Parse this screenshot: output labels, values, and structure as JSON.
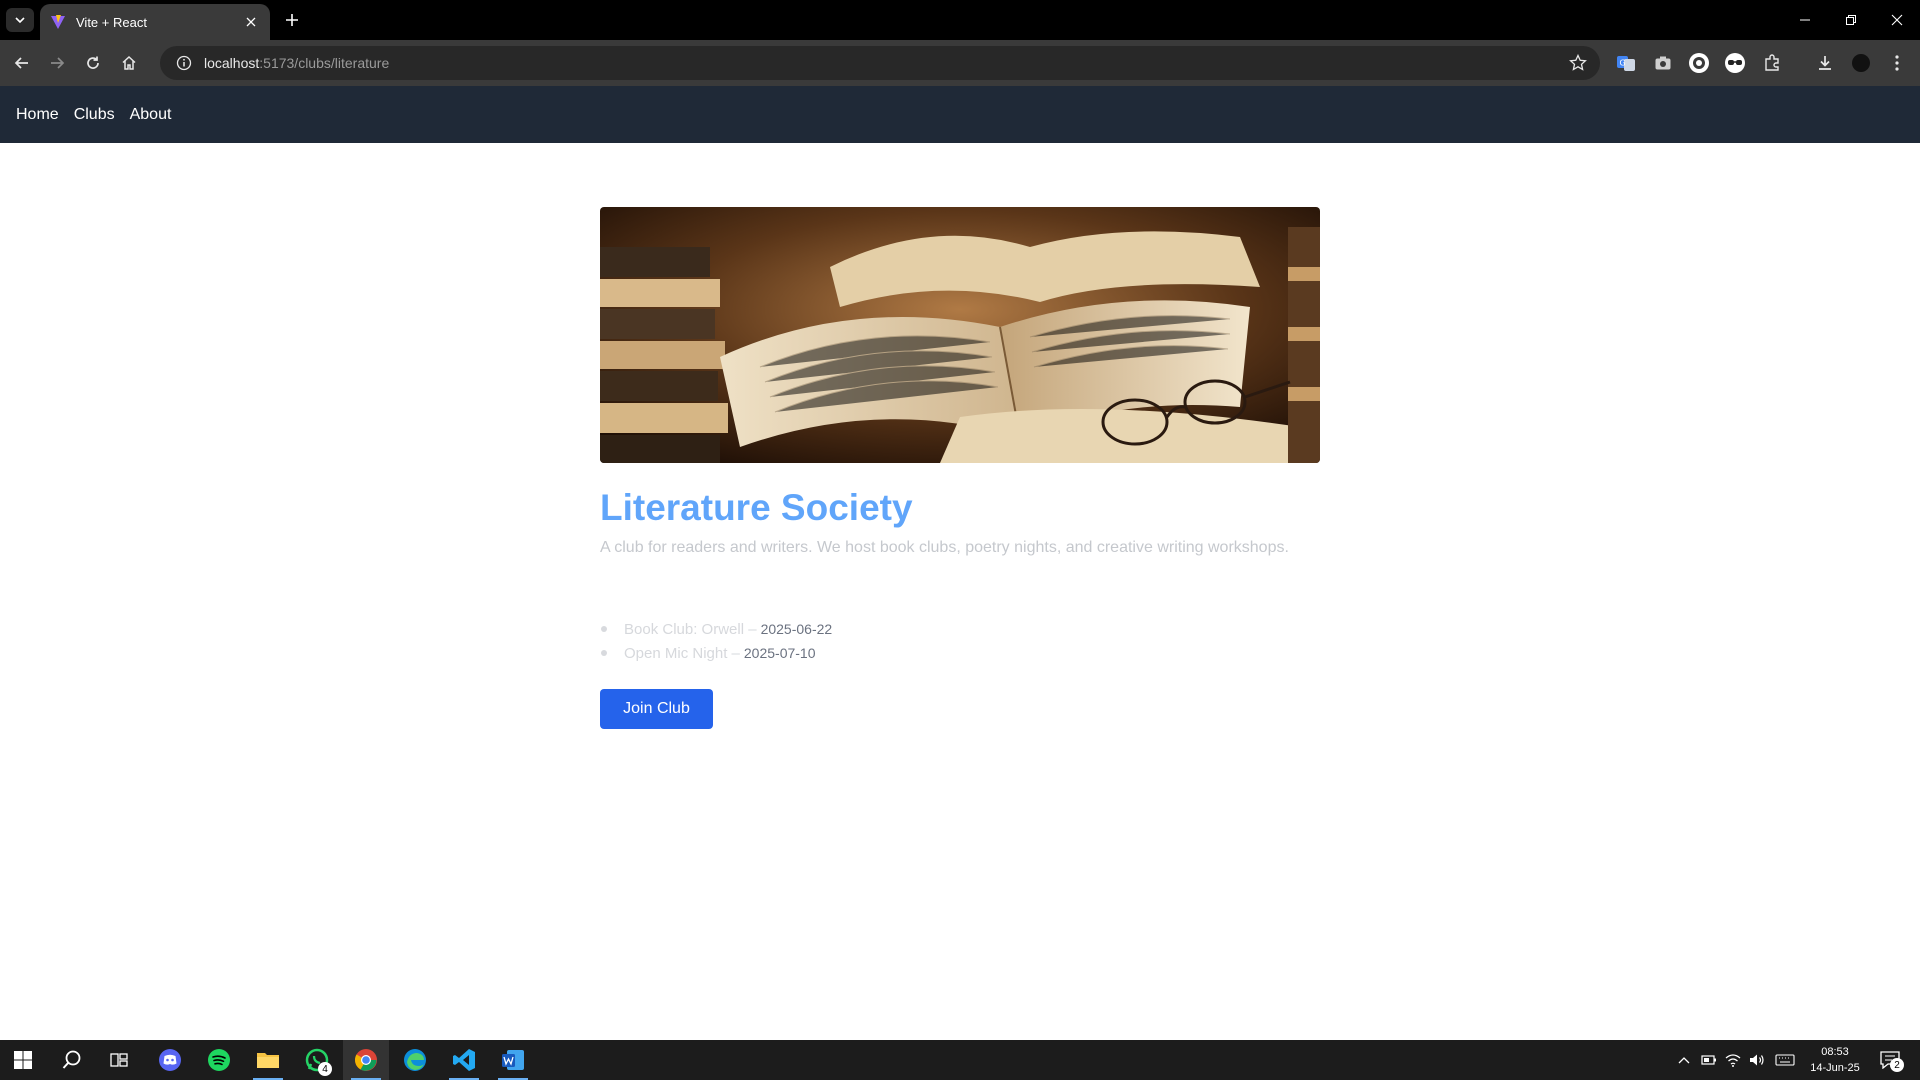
{
  "browser": {
    "tab_title": "Vite + React",
    "url_host": "localhost",
    "url_path": ":5173/clubs/literature"
  },
  "site_nav": {
    "links": [
      "Home",
      "Clubs",
      "About"
    ]
  },
  "club": {
    "title": "Literature Society",
    "description": "A club for readers and writers. We host book clubs, poetry nights, and creative writing workshops.",
    "events": [
      {
        "name": "Book Club: Orwell –",
        "date": "2025-06-22"
      },
      {
        "name": "Open Mic Night –",
        "date": "2025-07-10"
      }
    ],
    "join_label": "Join Club"
  },
  "taskbar": {
    "whatsapp_badge": "4",
    "time": "08:53",
    "date": "14-Jun-25",
    "notification_count": "2"
  },
  "colors": {
    "nav_bg": "#1f2937",
    "title": "#60a5fa",
    "button": "#2563eb"
  }
}
